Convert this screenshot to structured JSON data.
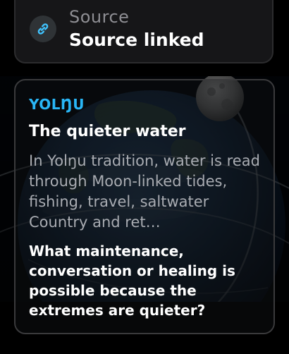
{
  "source": {
    "kicker": "Source",
    "title": "Source linked",
    "icon": "link-icon"
  },
  "story": {
    "eyebrow": "YOLŊU",
    "headline": "The quieter water",
    "body": "In Yolŋu tradition, water is read through Moon-linked tides, fishing, travel, saltwater Country and ret…",
    "prompt": "What maintenance, conversation or healing is possible because the extremes are quieter?"
  },
  "colors": {
    "accent": "#29b6f6",
    "background": "#000000",
    "card_border": "#3a3a3c"
  }
}
